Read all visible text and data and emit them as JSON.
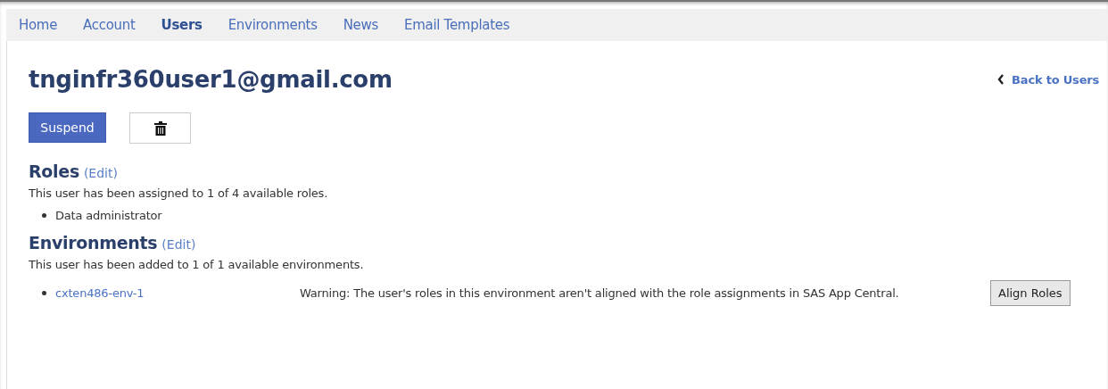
{
  "nav": {
    "tabs": [
      {
        "label": "Home",
        "selected": false
      },
      {
        "label": "Account",
        "selected": false
      },
      {
        "label": "Users",
        "selected": true
      },
      {
        "label": "Environments",
        "selected": false
      },
      {
        "label": "News",
        "selected": false
      },
      {
        "label": "Email Templates",
        "selected": false
      }
    ]
  },
  "title": "tnginfr360user1@gmail.com",
  "back_link": "Back to Users",
  "actions": {
    "suspend": "Suspend"
  },
  "sections": [
    {
      "heading": "Roles",
      "edit": "(Edit)",
      "summary": "This user has been assigned to 1 of 4 available roles.",
      "items": [
        {
          "kind": "text",
          "label": "Data administrator"
        }
      ]
    },
    {
      "heading": "Environments",
      "edit": "(Edit)",
      "summary": "This user has been added to 1 of 1 available environments.",
      "items": [
        {
          "kind": "link",
          "label": "cxten486-env-1",
          "warning": "Warning: The user's roles in this environment aren't aligned with the role assignments in SAS App Central.",
          "action": "Align Roles"
        }
      ]
    }
  ]
}
